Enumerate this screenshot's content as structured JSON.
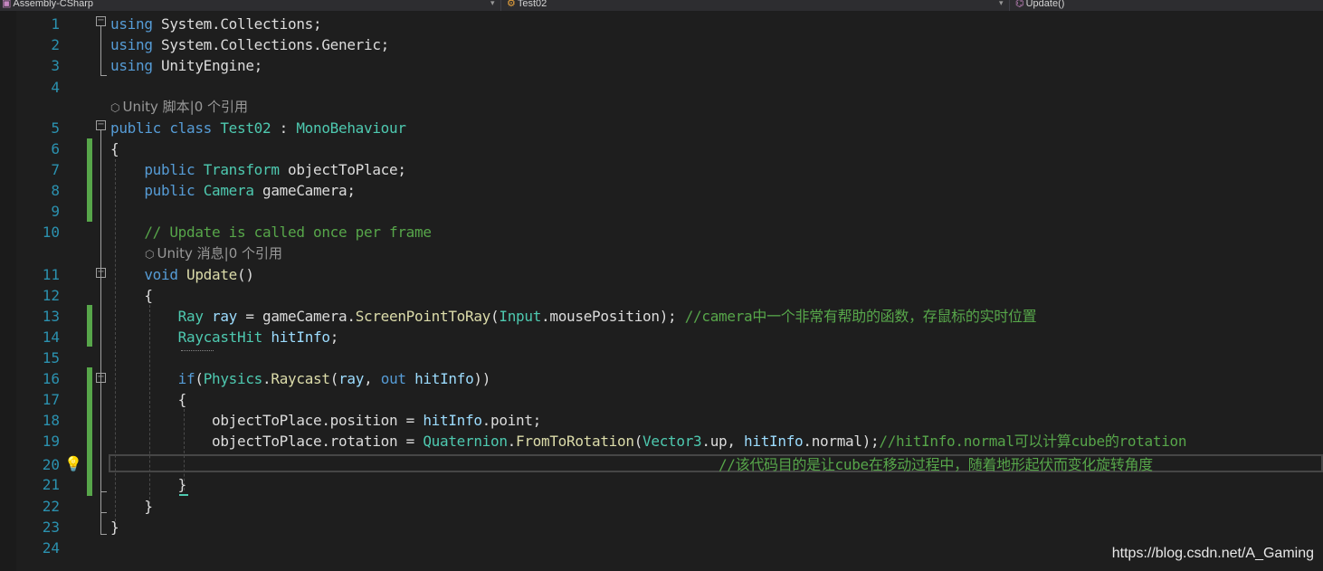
{
  "navbar": {
    "project": "Assembly-CSharp",
    "class_name": "Test02",
    "member": "Update()"
  },
  "lines": [
    {
      "n": "1",
      "tokens": [
        [
          "kw",
          "using"
        ],
        [
          "pl",
          " System.Collections;"
        ]
      ]
    },
    {
      "n": "2",
      "tokens": [
        [
          "kw",
          "using"
        ],
        [
          "pl",
          " System.Collections.Generic;"
        ]
      ]
    },
    {
      "n": "3",
      "tokens": [
        [
          "kw",
          "using"
        ],
        [
          "pl",
          " UnityEngine;"
        ]
      ]
    },
    {
      "n": "4",
      "tokens": []
    },
    {
      "n": "5",
      "tokens": [
        [
          "kw",
          "public class "
        ],
        [
          "ty",
          "Test02"
        ],
        [
          "pl",
          " : "
        ],
        [
          "ty",
          "MonoBehaviour"
        ]
      ]
    },
    {
      "n": "6",
      "tokens": [
        [
          "pl",
          "{"
        ]
      ]
    },
    {
      "n": "7",
      "tokens": [
        [
          "pl",
          "    "
        ],
        [
          "kw",
          "public "
        ],
        [
          "ty",
          "Transform"
        ],
        [
          "pl",
          " objectToPlace;"
        ]
      ]
    },
    {
      "n": "8",
      "tokens": [
        [
          "pl",
          "    "
        ],
        [
          "kw",
          "public "
        ],
        [
          "ty",
          "Camera"
        ],
        [
          "pl",
          " gameCamera;"
        ]
      ]
    },
    {
      "n": "9",
      "tokens": []
    },
    {
      "n": "10",
      "tokens": [
        [
          "pl",
          "    "
        ],
        [
          "cm",
          "// Update is called once per frame"
        ]
      ]
    },
    {
      "n": "11",
      "tokens": [
        [
          "pl",
          "    "
        ],
        [
          "kw",
          "void "
        ],
        [
          "fn",
          "Update"
        ],
        [
          "pl",
          "()"
        ]
      ]
    },
    {
      "n": "12",
      "tokens": [
        [
          "pl",
          "    {"
        ]
      ]
    },
    {
      "n": "13",
      "tokens": [
        [
          "pl",
          "        "
        ],
        [
          "ty",
          "Ray"
        ],
        [
          "pl",
          " "
        ],
        [
          "id",
          "ray"
        ],
        [
          "pl",
          " = gameCamera."
        ],
        [
          "fn",
          "ScreenPointToRay"
        ],
        [
          "pl",
          "("
        ],
        [
          "ty",
          "Input"
        ],
        [
          "pl",
          ".mousePosition); "
        ],
        [
          "cm",
          "//camera中一个非常有帮助的函数，存鼠标的实时位置"
        ]
      ]
    },
    {
      "n": "14",
      "tokens": [
        [
          "pl",
          "        "
        ],
        [
          "ty",
          "RaycastHit"
        ],
        [
          "pl",
          " "
        ],
        [
          "id",
          "hitInfo"
        ],
        [
          "pl",
          ";"
        ]
      ]
    },
    {
      "n": "15",
      "tokens": []
    },
    {
      "n": "16",
      "tokens": [
        [
          "pl",
          "        "
        ],
        [
          "kw",
          "if"
        ],
        [
          "pl",
          "("
        ],
        [
          "ty",
          "Physics"
        ],
        [
          "pl",
          "."
        ],
        [
          "fn",
          "Raycast"
        ],
        [
          "pl",
          "("
        ],
        [
          "id",
          "ray"
        ],
        [
          "pl",
          ", "
        ],
        [
          "kw",
          "out "
        ],
        [
          "id",
          "hitInfo"
        ],
        [
          "pl",
          "))"
        ]
      ]
    },
    {
      "n": "17",
      "tokens": [
        [
          "pl",
          "        {"
        ]
      ]
    },
    {
      "n": "18",
      "tokens": [
        [
          "pl",
          "            objectToPlace.position = "
        ],
        [
          "id",
          "hitInfo"
        ],
        [
          "pl",
          ".point;"
        ]
      ]
    },
    {
      "n": "19",
      "tokens": [
        [
          "pl",
          "            objectToPlace.rotation = "
        ],
        [
          "ty",
          "Quaternion"
        ],
        [
          "pl",
          "."
        ],
        [
          "fn",
          "FromToRotation"
        ],
        [
          "pl",
          "("
        ],
        [
          "ty",
          "Vector3"
        ],
        [
          "pl",
          ".up, "
        ],
        [
          "id",
          "hitInfo"
        ],
        [
          "pl",
          ".normal);"
        ],
        [
          "cm",
          "//hitInfo.normal可以计算cube的rotation"
        ]
      ]
    },
    {
      "n": "20",
      "tokens": [
        [
          "pl",
          "                                                                        "
        ],
        [
          "cm",
          "//该代码目的是让cube在移动过程中，随着地形起伏而变化旋转角度"
        ]
      ]
    },
    {
      "n": "21",
      "tokens": [
        [
          "pl",
          "        }"
        ]
      ]
    },
    {
      "n": "22",
      "tokens": [
        [
          "pl",
          "    }"
        ]
      ]
    },
    {
      "n": "23",
      "tokens": [
        [
          "pl",
          "}"
        ]
      ]
    },
    {
      "n": "24",
      "tokens": []
    }
  ],
  "codelens": [
    {
      "text": "Unity 脚本|0 个引用"
    },
    {
      "text": "Unity 消息|0 个引用"
    }
  ],
  "watermark": "https://blog.csdn.net/A_Gaming"
}
